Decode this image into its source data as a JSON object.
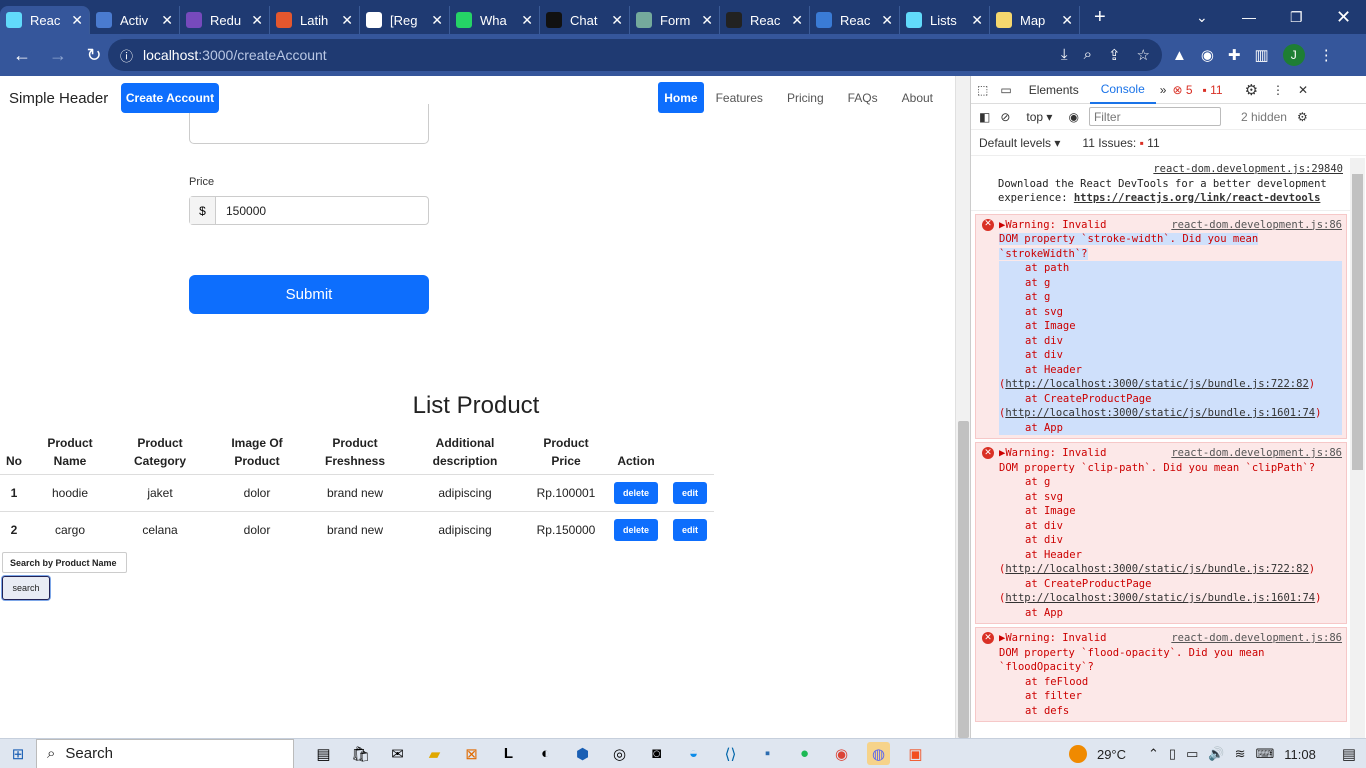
{
  "browser": {
    "tabs": [
      {
        "title": "Reac",
        "color": "#61dafb",
        "active": true
      },
      {
        "title": "Activ",
        "color": "#4a7bd0"
      },
      {
        "title": "Redu",
        "color": "#764abc"
      },
      {
        "title": "Latih",
        "color": "#e4572e"
      },
      {
        "title": "[Reg",
        "color": "#ffffff"
      },
      {
        "title": "Wha",
        "color": "#25d366"
      },
      {
        "title": "Chat",
        "color": "#111111"
      },
      {
        "title": "Form",
        "color": "#74aa9c"
      },
      {
        "title": "Reac",
        "color": "#222222"
      },
      {
        "title": "Reac",
        "color": "#3a7bd5"
      },
      {
        "title": "Lists",
        "color": "#61dafb"
      },
      {
        "title": "Map",
        "color": "#f5d76e"
      }
    ],
    "url_host": "localhost",
    "url_path": ":3000/createAccount",
    "profile_initial": "J"
  },
  "app": {
    "brand": "Simple Header",
    "create_account": "Create Account",
    "nav": [
      "Home",
      "Features",
      "Pricing",
      "FAQs",
      "About"
    ],
    "price_label": "Price",
    "currency": "$",
    "price_value": "150000",
    "submit": "Submit",
    "list_title": "List Product",
    "headers": [
      "No",
      "Product Name",
      "Product Category",
      "Image Of Product",
      "Product Freshness",
      "Additional description",
      "Product Price",
      "Action"
    ],
    "rows": [
      {
        "no": "1",
        "name": "hoodie",
        "category": "jaket",
        "image": "dolor",
        "freshness": "brand new",
        "desc": "adipiscing",
        "price": "Rp.100001"
      },
      {
        "no": "2",
        "name": "cargo",
        "category": "celana",
        "image": "dolor",
        "freshness": "brand new",
        "desc": "adipiscing",
        "price": "Rp.150000"
      }
    ],
    "delete_label": "delete",
    "edit_label": "edit",
    "search_label": "Search by Product Name",
    "search_button": "search"
  },
  "devtools": {
    "tabs": [
      "Elements",
      "Console"
    ],
    "errors": "5",
    "warnings": "11",
    "context": "top",
    "filter_placeholder": "Filter",
    "hidden": "2 hidden",
    "levels": "Default levels",
    "issues_label": "11 Issues:",
    "issues_count": "11",
    "info_src": "react-dom.development.js:29840",
    "info_text": "Download the React DevTools for a better development experience: ",
    "info_link": "https://reactjs.org/link/react-devtools",
    "err1_head": "▶Warning: Invalid",
    "err_src": "react-dom.development.js:86",
    "err1_body": "DOM property `stroke-width`. Did you mean `strokeWidth`?",
    "err1_stack": [
      "at path",
      "at g",
      "at g",
      "at svg",
      "at Image",
      "at div",
      "at div"
    ],
    "err2_head": "▶Warning: Invalid",
    "err2_body": "DOM property `clip-path`. Did you mean `clipPath`?",
    "err2_stack": [
      "at g",
      "at svg",
      "at Image",
      "at div",
      "at div"
    ],
    "err3_head": "▶Warning: Invalid",
    "err3_body": "DOM property `flood-opacity`. Did you mean `floodOpacity`?",
    "err3_stack": [
      "at feFlood",
      "at filter",
      "at defs"
    ],
    "header_at": "at Header (",
    "header_link": "http://localhost:3000/static/js/bundle.js:722:82",
    "cpp_at": "at CreateProductPage (",
    "cpp_link": "http://localhost:3000/static/js/bundle.js:1601:74",
    "app_at": "at App"
  },
  "taskbar": {
    "search": "Search",
    "weather": "29°C",
    "time": "11:08"
  }
}
